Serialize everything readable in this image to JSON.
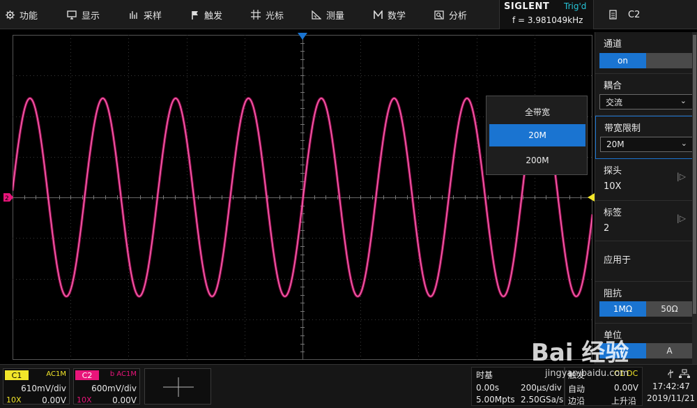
{
  "menu": {
    "function": "功能",
    "display": "显示",
    "acquire": "采样",
    "trigger": "触发",
    "cursor": "光标",
    "measure": "测量",
    "math": "数学",
    "analysis": "分析"
  },
  "brand": {
    "logo": "SIGLENT",
    "trig_status": "Trig'd",
    "frequency": "f = 3.981049kHz"
  },
  "channel_header": "C2",
  "panel": {
    "channel_title": "通道",
    "channel_on": "on",
    "coupling_title": "耦合",
    "coupling_value": "交流",
    "bw_limit_title": "带宽限制",
    "bw_limit_value": "20M",
    "probe_title": "探头",
    "probe_value": "10X",
    "label_title": "标签",
    "label_value": "2",
    "apply_to": "应用于",
    "impedance_title": "阻抗",
    "impedance_1m": "1MΩ",
    "impedance_50": "50Ω",
    "unit_title": "单位",
    "unit_v": "V",
    "unit_a": "A"
  },
  "popup": {
    "options": [
      "全带宽",
      "20M",
      "200M"
    ]
  },
  "c1": {
    "tag": "C1",
    "coupling": "AC1M",
    "scale": "610mV/div",
    "probe": "10X",
    "offset": "0.00V"
  },
  "c2": {
    "tag": "C2",
    "coupling": "b AC1M",
    "scale": "600mV/div",
    "probe": "10X",
    "offset": "0.00V"
  },
  "timebase": {
    "title": "时基",
    "delay": "0.00s",
    "scale": "200μs/div",
    "memory": "5.00Mpts",
    "rate": "2.50GSa/s"
  },
  "trigger_info": {
    "title": "触发",
    "source": "C1 DC",
    "mode": "自动",
    "level": "0.00V",
    "type": "边沿",
    "slope": "上升沿"
  },
  "clock": {
    "time": "17:42:47",
    "date": "2019/11/21"
  },
  "watermark": {
    "text": "Bai 经验",
    "sub": "jingyan.baidu.com"
  },
  "colors": {
    "accent": "#1a74d1",
    "trace": "#ff5fb0",
    "c1": "#f2e62a",
    "c2": "#e8157a",
    "trig_text": "#27c5d8"
  }
}
